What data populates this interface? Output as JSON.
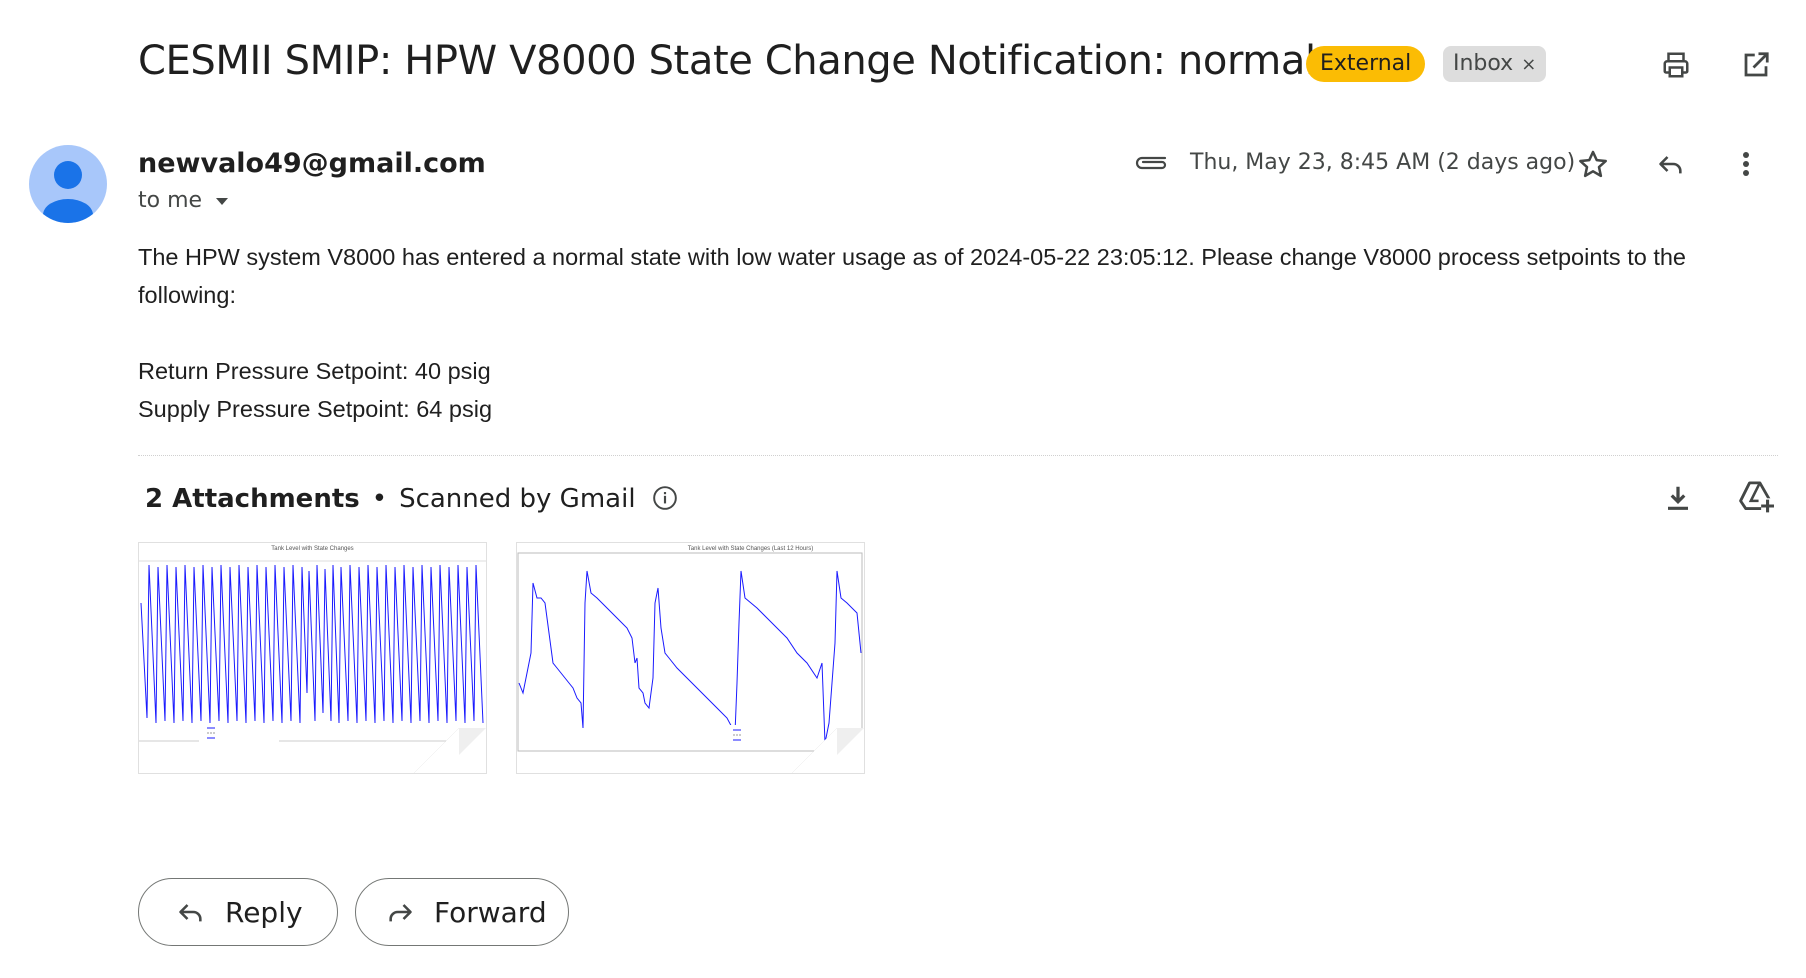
{
  "email": {
    "subject": "CESMII SMIP: HPW V8000 State Change Notification: normal",
    "labels": {
      "external": "External",
      "inbox": "Inbox",
      "inbox_close": "×"
    },
    "sender": "newvalo49@gmail.com",
    "to_line": "to me",
    "date": "Thu, May 23, 8:45 AM (2 days ago)",
    "body": {
      "paragraph": "The HPW system V8000 has entered a normal state with low water usage as of 2024-05-22 23:05:12. Please change V8000 process setpoints to the following:",
      "line1": "Return Pressure Setpoint: 40 psig",
      "line2": "Supply Pressure Setpoint: 64 psig"
    }
  },
  "attachments": {
    "count_label": "2 Attachments",
    "separator": "•",
    "scanned_label": "Scanned by Gmail",
    "items": [
      {
        "title": "Tank Level with State Changes"
      },
      {
        "title": "Tank Level with State Changes (Last 12 Hours)"
      }
    ]
  },
  "actions": {
    "reply": "Reply",
    "forward": "Forward"
  },
  "colors": {
    "external_badge": "#fbbc04",
    "inbox_badge": "#dddddd",
    "avatar": "#a8c7fa",
    "avatar_figure": "#1a73e8",
    "chart_line": "#1a1aff"
  },
  "icons": [
    "print-icon",
    "open-in-new-icon",
    "attachment-clip-icon",
    "star-icon",
    "reply-icon",
    "more-vert-icon",
    "dropdown-arrow-icon",
    "info-icon",
    "download-icon",
    "add-to-drive-icon",
    "forward-icon"
  ]
}
